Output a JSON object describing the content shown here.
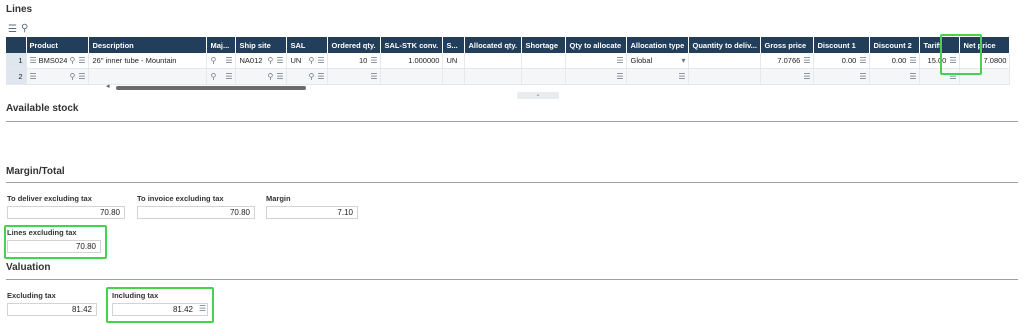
{
  "lines": {
    "title": "Lines",
    "columns": [
      "",
      "Product",
      "Description",
      "Maj...",
      "Ship site",
      "SAL",
      "Ordered qty.",
      "SAL-STK conv.",
      "S...",
      "Allocated qty.",
      "Shortage",
      "Qty to allocate",
      "Allocation type",
      "Quantity to deliv...",
      "Gross price",
      "Discount 1",
      "Discount 2",
      "Tariff",
      "Net price"
    ],
    "rows": [
      {
        "num": "1",
        "product": "BMS024",
        "description": "26\" inner tube - Mountain",
        "ship_site": "NA012",
        "sal": "UN",
        "ordered_qty": "10",
        "conv": "1.000000",
        "stk": "UN",
        "allocation_type": "Global",
        "gross_price": "7.0766",
        "discount1": "0.00",
        "discount2": "0.00",
        "tariff": "15.00",
        "net_price": "7.0800"
      },
      {
        "num": "2"
      }
    ]
  },
  "available_stock": {
    "title": "Available stock"
  },
  "margin_total": {
    "title": "Margin/Total",
    "to_deliver_label": "To deliver excluding tax",
    "to_deliver_value": "70.80",
    "to_invoice_label": "To invoice excluding tax",
    "to_invoice_value": "70.80",
    "margin_label": "Margin",
    "margin_value": "7.10",
    "lines_excl_label": "Lines excluding tax",
    "lines_excl_value": "70.80"
  },
  "valuation": {
    "title": "Valuation",
    "excl_label": "Excluding tax",
    "excl_value": "81.42",
    "incl_label": "Including tax",
    "incl_value": "81.42"
  },
  "colors": {
    "header_bg": "#233e5b",
    "highlight": "#46d24a"
  },
  "icons": [
    "list-icon",
    "search-icon",
    "chevron-down-icon",
    "scroll-left-icon"
  ]
}
